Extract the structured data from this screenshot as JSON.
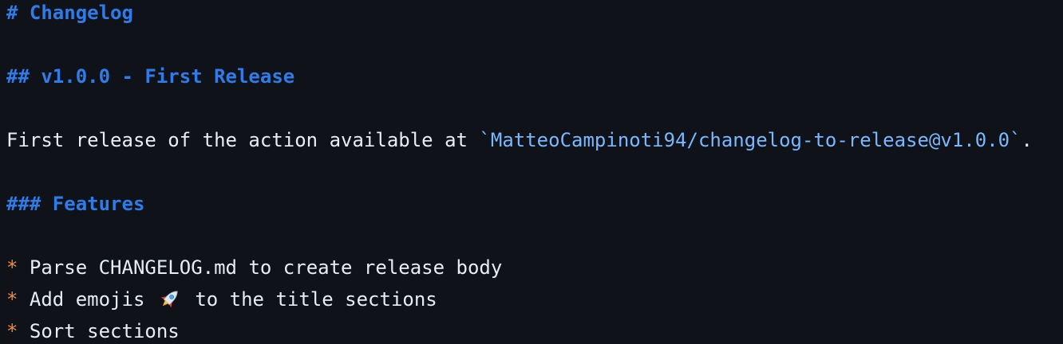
{
  "document": {
    "title": "# Changelog",
    "version_heading": "## v1.0.0 - First Release",
    "intro": {
      "text": "First release of the action available at ",
      "code": "`MatteoCampinoti94/changelog-to-release@v1.0.0`",
      "suffix": "."
    },
    "features_heading": "### Features",
    "features": [
      {
        "bullet": "*",
        "text": "Parse CHANGELOG.md to create release body"
      },
      {
        "bullet": "*",
        "text_before": "Add emojis",
        "emoji_icon": "rocket-icon",
        "text_after": "to the title sections"
      },
      {
        "bullet": "*",
        "text": "Sort sections"
      }
    ]
  },
  "colors": {
    "background": "#0f1218",
    "heading": "#2f7ce8",
    "text": "#e6edf3",
    "code": "#79b8ff",
    "bullet": "#f0883e"
  }
}
